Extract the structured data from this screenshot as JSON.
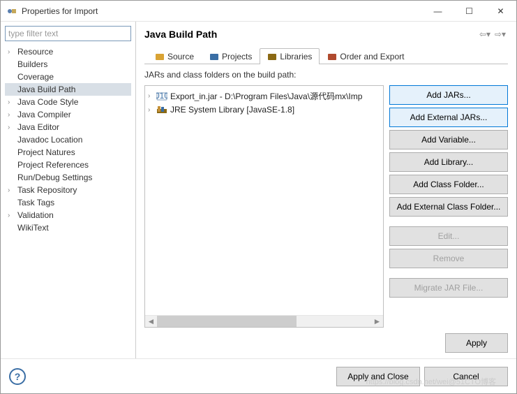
{
  "window": {
    "title": "Properties for Import"
  },
  "filter": {
    "placeholder": "type filter text"
  },
  "tree": [
    {
      "label": "Resource",
      "expandable": true
    },
    {
      "label": "Builders",
      "expandable": false
    },
    {
      "label": "Coverage",
      "expandable": false
    },
    {
      "label": "Java Build Path",
      "expandable": false,
      "selected": true
    },
    {
      "label": "Java Code Style",
      "expandable": true
    },
    {
      "label": "Java Compiler",
      "expandable": true
    },
    {
      "label": "Java Editor",
      "expandable": true
    },
    {
      "label": "Javadoc Location",
      "expandable": false
    },
    {
      "label": "Project Natures",
      "expandable": false
    },
    {
      "label": "Project References",
      "expandable": false
    },
    {
      "label": "Run/Debug Settings",
      "expandable": false
    },
    {
      "label": "Task Repository",
      "expandable": true
    },
    {
      "label": "Task Tags",
      "expandable": false
    },
    {
      "label": "Validation",
      "expandable": true
    },
    {
      "label": "WikiText",
      "expandable": false
    }
  ],
  "header": {
    "title": "Java Build Path"
  },
  "tabs": [
    {
      "label": "Source",
      "icon": "source-folder-icon"
    },
    {
      "label": "Projects",
      "icon": "projects-icon"
    },
    {
      "label": "Libraries",
      "icon": "libraries-icon",
      "active": true
    },
    {
      "label": "Order and Export",
      "icon": "order-export-icon"
    }
  ],
  "tabdesc": "JARs and class folders on the build path:",
  "jars": [
    {
      "label": "Export_in.jar - D:\\Program Files\\Java\\源代码mx\\Imp",
      "icon": "jar-icon"
    },
    {
      "label": "JRE System Library [JavaSE-1.8]",
      "icon": "jre-library-icon"
    }
  ],
  "buttons": {
    "add_jars": "Add JARs...",
    "add_ext_jars": "Add External JARs...",
    "add_variable": "Add Variable...",
    "add_library": "Add Library...",
    "add_class_folder": "Add Class Folder...",
    "add_ext_class_folder": "Add External Class Folder...",
    "edit": "Edit...",
    "remove": "Remove",
    "migrate": "Migrate JAR File...",
    "apply": "Apply"
  },
  "footer": {
    "apply_close": "Apply and Close",
    "cancel": "Cancel"
  },
  "watermark": "https://blog.csdn.net/wei@51CTO博客"
}
